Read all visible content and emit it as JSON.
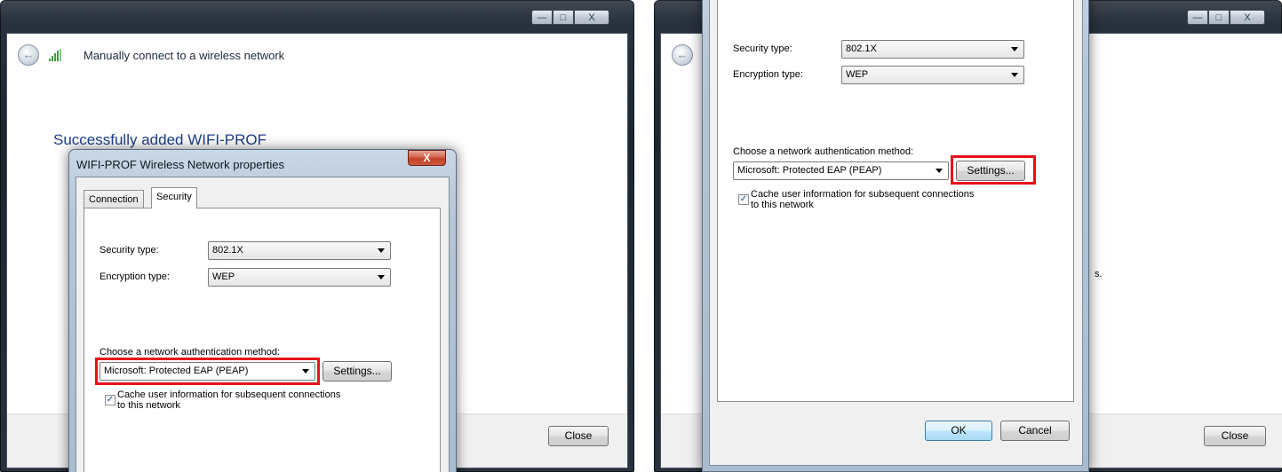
{
  "wizard": {
    "title": "Manually connect to a wireless network",
    "success_message": "Successfully added WIFI-PROF",
    "close_label": "Close",
    "caption": {
      "minimize": "—",
      "maximize": "□",
      "close": "X"
    }
  },
  "dialog": {
    "title": "WIFI-PROF Wireless Network properties",
    "close_glyph": "X",
    "tabs": [
      {
        "label": "Connection"
      },
      {
        "label": "Security"
      }
    ],
    "security_type_label": "Security type:",
    "security_type_value": "802.1X",
    "encryption_type_label": "Encryption type:",
    "encryption_type_value": "WEP",
    "auth_method_label": "Choose a network authentication method:",
    "auth_method_value": "Microsoft: Protected EAP (PEAP)",
    "settings_label": "Settings...",
    "cache_checked": true,
    "cache_line1": "Cache user information for subsequent connections",
    "cache_line2": "to this network",
    "ok_label": "OK",
    "cancel_label": "Cancel"
  },
  "partial_text": "s.",
  "colors": {
    "highlight": "#e8101a",
    "success_text": "#1e3f86",
    "ok_border": "#3c7fb1"
  },
  "icons": [
    "back-arrow-icon",
    "wireless-signal-icon",
    "dropdown-arrow-icon",
    "checkmark-icon"
  ]
}
